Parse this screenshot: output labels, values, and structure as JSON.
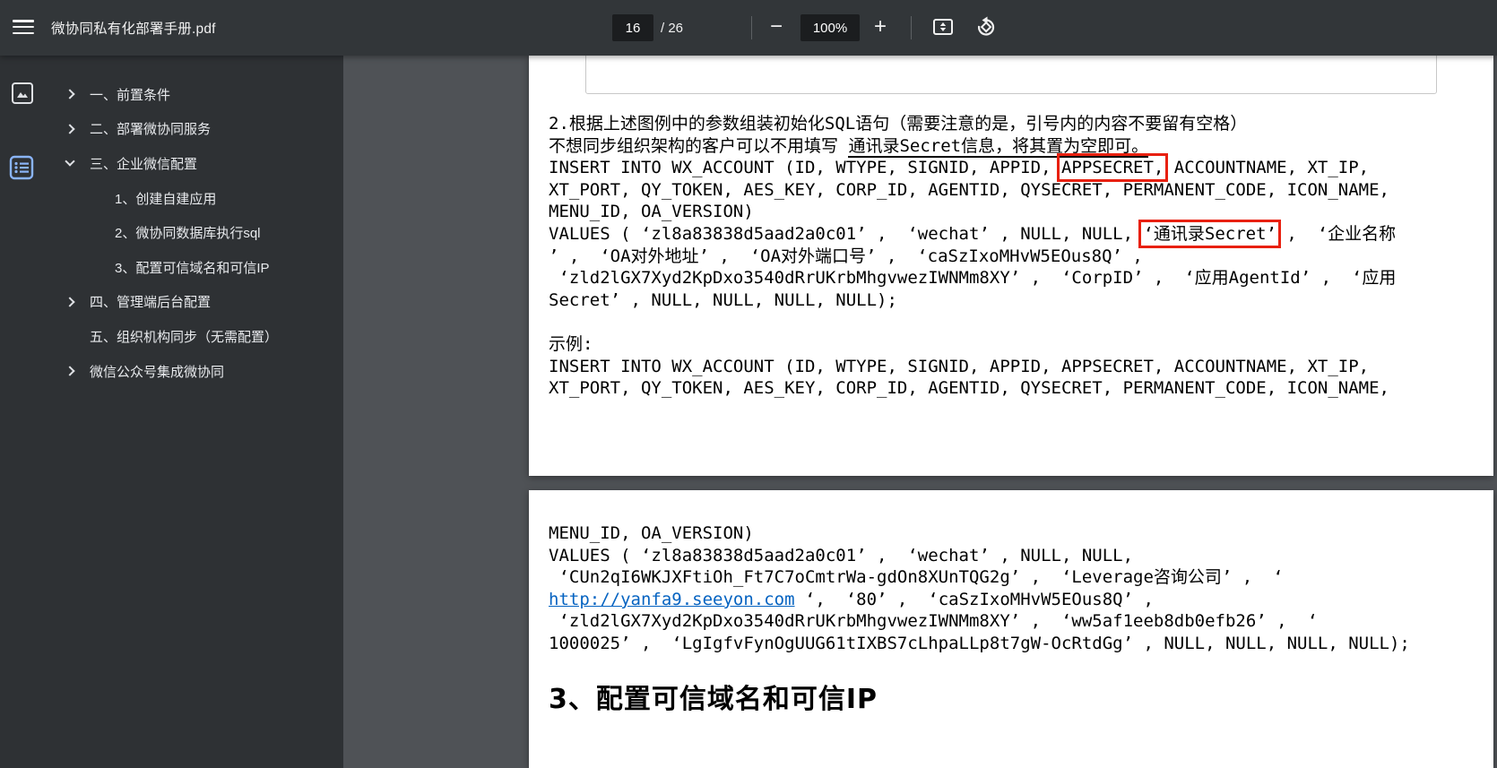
{
  "toolbar": {
    "title": "微协同私有化部署手册.pdf",
    "page_current": "16",
    "page_total": "/ 26",
    "zoom_level": "100%",
    "minus_label": "−",
    "plus_label": "+"
  },
  "sidebar": {
    "items": [
      {
        "label": "一、前置条件",
        "chevron": "right",
        "level": 0
      },
      {
        "label": "二、部署微协同服务",
        "chevron": "right",
        "level": 0
      },
      {
        "label": "三、企业微信配置",
        "chevron": "down",
        "level": 0
      },
      {
        "label": "1、创建自建应用",
        "chevron": "none",
        "level": 1
      },
      {
        "label": "2、微协同数据库执行sql",
        "chevron": "none",
        "level": 1
      },
      {
        "label": "3、配置可信域名和可信IP",
        "chevron": "none",
        "level": 1
      },
      {
        "label": "四、管理端后台配置",
        "chevron": "right",
        "level": 0
      },
      {
        "label": "五、组织机构同步（无需配置）",
        "chevron": "none",
        "level": 0
      },
      {
        "label": "微信公众号集成微协同",
        "chevron": "right",
        "level": 0
      }
    ]
  },
  "page1": {
    "lines": [
      [
        {
          "t": "2.根据上述图例中的参数组装初始化SQL语句（需要注意的是，引号内的内容不要留有空格）"
        }
      ],
      [
        {
          "t": "不想同步组织架构的客户可以不用填写 "
        },
        {
          "t": "通讯录Secret信息，将其置为空即可。",
          "s": "underline"
        }
      ],
      [
        {
          "t": "INSERT INTO WX_ACCOUNT (ID, WTYPE, SIGNID, APPID, "
        },
        {
          "t": "APPSECRET,",
          "s": "redbox"
        },
        {
          "t": " ACCOUNTNAME, XT_IP,"
        }
      ],
      [
        {
          "t": "XT_PORT, QY_TOKEN, AES_KEY, CORP_ID, AGENTID, QYSECRET, PERMANENT_CODE, ICON_NAME,"
        }
      ],
      [
        {
          "t": "MENU_ID, OA_VERSION)"
        }
      ],
      [
        {
          "t": "VALUES ( ‘zl8a83838d5aad2a0c01’ ,  ‘wechat’ , NULL, NULL, "
        },
        {
          "t": "‘通讯录Secret’",
          "s": "redbox"
        },
        {
          "t": " ,  ‘企业名称"
        }
      ],
      [
        {
          "t": "’ ,  ‘OA对外地址’ ,  ‘OA对外端口号’ ,  ‘caSzIxoMHvW5EOus8Q’ ,"
        }
      ],
      [
        {
          "t": " ‘zld2lGX7Xyd2KpDxo3540dRrUKrbMhgvwezIWNMm8XY’ ,  ‘CorpID’ ,  ‘应用AgentId’ ,  ‘应用"
        }
      ],
      [
        {
          "t": "Secret’ , NULL, NULL, NULL, NULL);"
        }
      ],
      [
        {
          "t": ""
        }
      ],
      [
        {
          "t": "示例:"
        }
      ],
      [
        {
          "t": "INSERT INTO WX_ACCOUNT (ID, WTYPE, SIGNID, APPID, APPSECRET, ACCOUNTNAME, XT_IP,"
        }
      ],
      [
        {
          "t": "XT_PORT, QY_TOKEN, AES_KEY, CORP_ID, AGENTID, QYSECRET, PERMANENT_CODE, ICON_NAME,"
        }
      ]
    ]
  },
  "page2": {
    "lines": [
      [
        {
          "t": "MENU_ID, OA_VERSION)"
        }
      ],
      [
        {
          "t": "VALUES ( ‘zl8a83838d5aad2a0c01’ ,  ‘wechat’ , NULL, NULL,"
        }
      ],
      [
        {
          "t": " ‘CUn2qI6WKJXFtiOh_Ft7C7oCmtrWa-gdOn8XUnTQG2g’ ,  ‘Leverage咨询公司’ ,  ‘"
        }
      ],
      [
        {
          "t": "http://yanfa9.seeyon.com",
          "s": "link"
        },
        {
          "t": " ‘,  ‘80’ ,  ‘caSzIxoMHvW5EOus8Q’ ,"
        }
      ],
      [
        {
          "t": " ‘zld2lGX7Xyd2KpDxo3540dRrUKrbMhgvwezIWNMm8XY’ ,  ‘ww5af1eeb8db0efb26’ ,  ‘"
        }
      ],
      [
        {
          "t": "1000025’ ,  ‘LgIgfvFynOgUUG61tIXBS7cLhpaLLp8t7gW-OcRtdGg’ , NULL, NULL, NULL, NULL);"
        }
      ]
    ],
    "heading": "3、配置可信域名和可信IP"
  },
  "colors": {
    "toolbar_bg": "#323639",
    "sidebar_bg": "#2e3134",
    "canvas_bg": "#4f5256",
    "accent_blue": "#8ab4f8",
    "red_box": "#e8200f",
    "link_blue": "#0563c1"
  }
}
